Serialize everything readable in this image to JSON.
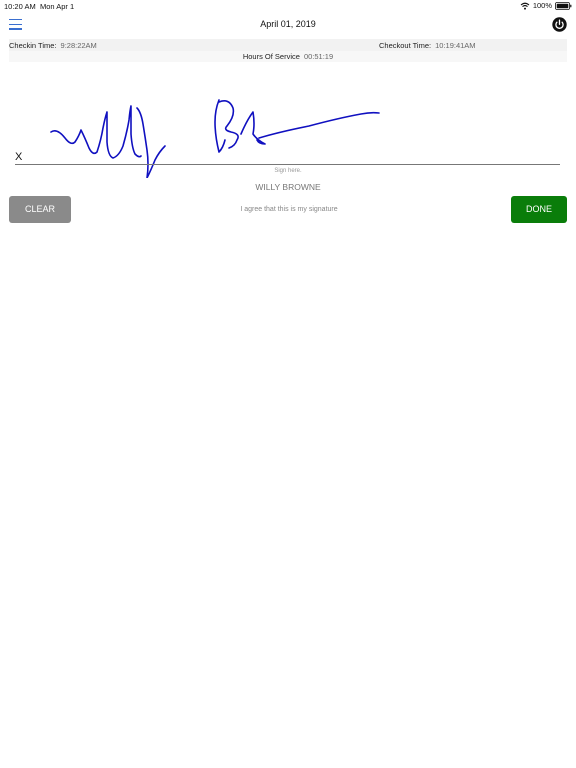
{
  "status_bar": {
    "time": "10:20 AM",
    "date": "Mon Apr 1",
    "battery": "100%"
  },
  "header": {
    "title": "April 01, 2019"
  },
  "times": {
    "checkin_label": "Checkin Time:",
    "checkin_value": "9:28:22AM",
    "checkout_label": "Checkout Time:",
    "checkout_value": "10:19:41AM",
    "hours_label": "Hours Of Service",
    "hours_value": "00:51:19"
  },
  "signature": {
    "x_mark": "X",
    "hint": "Sign here.",
    "name": "WILLY BROWNE",
    "ink_color": "#1010c0"
  },
  "actions": {
    "clear_label": "CLEAR",
    "agree_text": "I agree that this is my signature",
    "done_label": "DONE"
  },
  "colors": {
    "clear_button": "#8a8a8a",
    "done_button": "#0a7d0a",
    "menu_icon": "#3a6fd0"
  },
  "icons": [
    "menu-icon",
    "power-icon",
    "wifi-icon",
    "battery-icon"
  ]
}
